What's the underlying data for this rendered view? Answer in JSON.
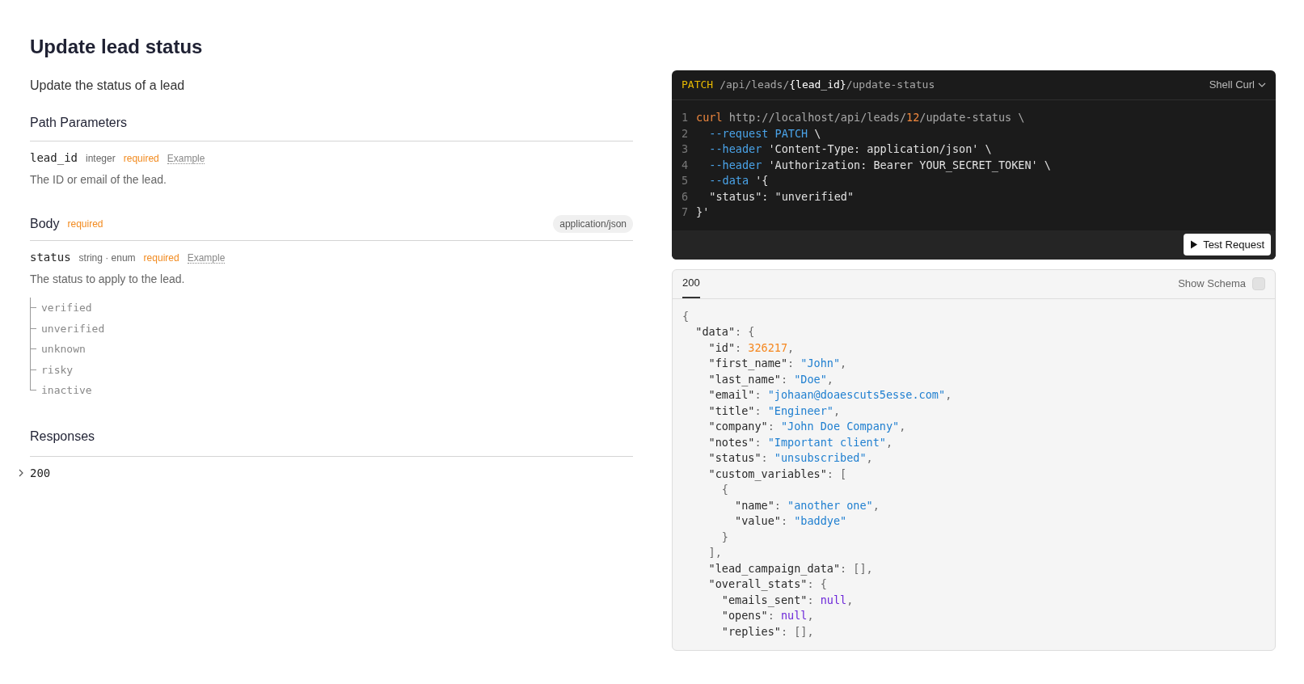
{
  "title": "Update lead status",
  "description": "Update the status of a lead",
  "path_parameters": {
    "heading": "Path Parameters",
    "params": [
      {
        "name": "lead_id",
        "type": "integer",
        "required": "required",
        "example": "Example",
        "description": "The ID or email of the lead."
      }
    ]
  },
  "body": {
    "heading": "Body",
    "required": "required",
    "content_type": "application/json",
    "params": [
      {
        "name": "status",
        "type": "string · enum",
        "required": "required",
        "example": "Example",
        "description": "The status to apply to the lead.",
        "enum": [
          "verified",
          "unverified",
          "unknown",
          "risky",
          "inactive"
        ]
      }
    ]
  },
  "responses": {
    "heading": "Responses",
    "items": [
      {
        "code": "200",
        "expanded": false
      }
    ]
  },
  "request": {
    "method": "PATCH",
    "path": [
      {
        "text": "/api/leads/",
        "kind": "plain"
      },
      {
        "text": "{lead_id}",
        "kind": "param"
      },
      {
        "text": "/update-status",
        "kind": "plain"
      }
    ],
    "language": "Shell Curl",
    "button": "Test Request",
    "lines": [
      {
        "number": "1",
        "tokens": [
          {
            "text": "curl",
            "kind": "cmd"
          },
          {
            "text": " http://localhost/api/leads/",
            "kind": "url"
          },
          {
            "text": "12",
            "kind": "cmd"
          },
          {
            "text": "/update-status \\",
            "kind": "url"
          }
        ]
      },
      {
        "number": "2",
        "tokens": [
          {
            "text": "  --request PATCH",
            "kind": "flag"
          },
          {
            "text": " \\",
            "kind": "plain"
          }
        ]
      },
      {
        "number": "3",
        "tokens": [
          {
            "text": "  --header",
            "kind": "flag"
          },
          {
            "text": " 'Content-Type: application/json' \\",
            "kind": "plain"
          }
        ]
      },
      {
        "number": "4",
        "tokens": [
          {
            "text": "  --header",
            "kind": "flag"
          },
          {
            "text": " 'Authorization: Bearer YOUR_SECRET_TOKEN' \\",
            "kind": "plain"
          }
        ]
      },
      {
        "number": "5",
        "tokens": [
          {
            "text": "  --data",
            "kind": "flag"
          },
          {
            "text": " '{",
            "kind": "plain"
          }
        ]
      },
      {
        "number": "6",
        "tokens": [
          {
            "text": "  \"status\": \"unverified\"",
            "kind": "plain"
          }
        ]
      },
      {
        "number": "7",
        "tokens": [
          {
            "text": "}'",
            "kind": "plain"
          }
        ]
      }
    ]
  },
  "response": {
    "tabs": [
      {
        "label": "200",
        "selected": true
      }
    ],
    "show_schema": {
      "label": "Show Schema",
      "checked": false
    },
    "lines": [
      [
        {
          "text": "{",
          "kind": "punct"
        }
      ],
      [
        {
          "text": "  \"data\"",
          "kind": "key"
        },
        {
          "text": ": {",
          "kind": "punct"
        }
      ],
      [
        {
          "text": "    \"id\"",
          "kind": "key"
        },
        {
          "text": ": ",
          "kind": "punct"
        },
        {
          "text": "326217",
          "kind": "num"
        },
        {
          "text": ",",
          "kind": "punct"
        }
      ],
      [
        {
          "text": "    \"first_name\"",
          "kind": "key"
        },
        {
          "text": ": ",
          "kind": "punct"
        },
        {
          "text": "\"John\"",
          "kind": "str"
        },
        {
          "text": ",",
          "kind": "punct"
        }
      ],
      [
        {
          "text": "    \"last_name\"",
          "kind": "key"
        },
        {
          "text": ": ",
          "kind": "punct"
        },
        {
          "text": "\"Doe\"",
          "kind": "str"
        },
        {
          "text": ",",
          "kind": "punct"
        }
      ],
      [
        {
          "text": "    \"email\"",
          "kind": "key"
        },
        {
          "text": ": ",
          "kind": "punct"
        },
        {
          "text": "\"johaan@doaescuts5esse.com\"",
          "kind": "str"
        },
        {
          "text": ",",
          "kind": "punct"
        }
      ],
      [
        {
          "text": "    \"title\"",
          "kind": "key"
        },
        {
          "text": ": ",
          "kind": "punct"
        },
        {
          "text": "\"Engineer\"",
          "kind": "str"
        },
        {
          "text": ",",
          "kind": "punct"
        }
      ],
      [
        {
          "text": "    \"company\"",
          "kind": "key"
        },
        {
          "text": ": ",
          "kind": "punct"
        },
        {
          "text": "\"John Doe Company\"",
          "kind": "str"
        },
        {
          "text": ",",
          "kind": "punct"
        }
      ],
      [
        {
          "text": "    \"notes\"",
          "kind": "key"
        },
        {
          "text": ": ",
          "kind": "punct"
        },
        {
          "text": "\"Important client\"",
          "kind": "str"
        },
        {
          "text": ",",
          "kind": "punct"
        }
      ],
      [
        {
          "text": "    \"status\"",
          "kind": "key"
        },
        {
          "text": ": ",
          "kind": "punct"
        },
        {
          "text": "\"unsubscribed\"",
          "kind": "str"
        },
        {
          "text": ",",
          "kind": "punct"
        }
      ],
      [
        {
          "text": "    \"custom_variables\"",
          "kind": "key"
        },
        {
          "text": ": [",
          "kind": "punct"
        }
      ],
      [
        {
          "text": "      {",
          "kind": "punct"
        }
      ],
      [
        {
          "text": "        \"name\"",
          "kind": "key"
        },
        {
          "text": ": ",
          "kind": "punct"
        },
        {
          "text": "\"another one\"",
          "kind": "str"
        },
        {
          "text": ",",
          "kind": "punct"
        }
      ],
      [
        {
          "text": "        \"value\"",
          "kind": "key"
        },
        {
          "text": ": ",
          "kind": "punct"
        },
        {
          "text": "\"baddye\"",
          "kind": "str"
        }
      ],
      [
        {
          "text": "      }",
          "kind": "punct"
        }
      ],
      [
        {
          "text": "    ],",
          "kind": "punct"
        }
      ],
      [
        {
          "text": "    \"lead_campaign_data\"",
          "kind": "key"
        },
        {
          "text": ": [],",
          "kind": "punct"
        }
      ],
      [
        {
          "text": "    \"overall_stats\"",
          "kind": "key"
        },
        {
          "text": ": {",
          "kind": "punct"
        }
      ],
      [
        {
          "text": "      \"emails_sent\"",
          "kind": "key"
        },
        {
          "text": ": ",
          "kind": "punct"
        },
        {
          "text": "null",
          "kind": "null"
        },
        {
          "text": ",",
          "kind": "punct"
        }
      ],
      [
        {
          "text": "      \"opens\"",
          "kind": "key"
        },
        {
          "text": ": ",
          "kind": "punct"
        },
        {
          "text": "null",
          "kind": "null"
        },
        {
          "text": ",",
          "kind": "punct"
        }
      ],
      [
        {
          "text": "      \"replies\"",
          "kind": "key"
        },
        {
          "text": ": [],",
          "kind": "punct"
        }
      ]
    ]
  }
}
